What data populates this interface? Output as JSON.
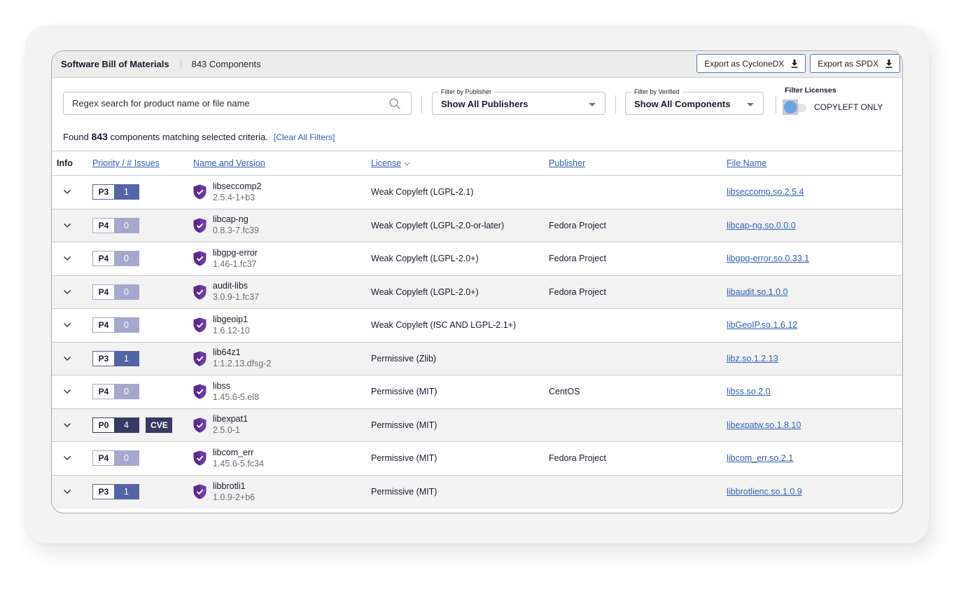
{
  "header": {
    "title": "Software Bill of Materials",
    "component_count": "843 Components",
    "export_cyclonedx": "Export as CycloneDX",
    "export_spdx": "Export as SPDX"
  },
  "filters": {
    "search_placeholder": "Regex search for product name or file name",
    "search_value": "",
    "publisher_legend": "Filter by Publisher",
    "publisher_value": "Show All Publishers",
    "verified_legend": "Filter by Verified",
    "verified_value": "Show All Components",
    "licenses_label": "Filter Licenses",
    "copyleft_toggle_label": "COPYLEFT ONLY",
    "copyleft_toggle_on": false,
    "found_prefix": "Found",
    "found_count": "843",
    "found_suffix": "components matching selected criteria.",
    "clear_all": "[Clear All Filters]"
  },
  "colors": {
    "priority_p3": "#5564a6",
    "priority_p4": "#a3a8cc",
    "priority_p0": "#363b63",
    "cve_badge": "#363b63",
    "shield": "#5a2a8a",
    "link": "#2f5fb3",
    "toggle_knob": "#6aa3e8"
  },
  "table": {
    "columns": {
      "info": "Info",
      "priority": "Priority / # Issues",
      "name": "Name and Version",
      "license": "License",
      "publisher": "Publisher",
      "file": "File Name"
    },
    "rows": [
      {
        "priority": "P3",
        "issues": "1",
        "cve": "",
        "name": "libseccomp2",
        "version": "2.5.4-1+b3",
        "license": "Weak Copyleft (LGPL-2.1)",
        "publisher": "",
        "file": "libseccomp.so.2.5.4"
      },
      {
        "priority": "P4",
        "issues": "0",
        "cve": "",
        "name": "libcap-ng",
        "version": "0.8.3-7.fc39",
        "license": "Weak Copyleft (LGPL-2.0-or-later)",
        "publisher": "Fedora Project",
        "file": "libcap-ng.so.0.0.0"
      },
      {
        "priority": "P4",
        "issues": "0",
        "cve": "",
        "name": "libgpg-error",
        "version": "1.46-1.fc37",
        "license": "Weak Copyleft (LGPL-2.0+)",
        "publisher": "Fedora Project",
        "file": "libgpg-error.so.0.33.1"
      },
      {
        "priority": "P4",
        "issues": "0",
        "cve": "",
        "name": "audit-libs",
        "version": "3.0.9-1.fc37",
        "license": "Weak Copyleft (LGPL-2.0+)",
        "publisher": "Fedora Project",
        "file": "libaudit.so.1.0.0"
      },
      {
        "priority": "P4",
        "issues": "0",
        "cve": "",
        "name": "libgeoip1",
        "version": "1.6.12-10",
        "license": "Weak Copyleft (ISC AND LGPL-2.1+)",
        "publisher": "",
        "file": "libGeoIP.so.1.6.12"
      },
      {
        "priority": "P3",
        "issues": "1",
        "cve": "",
        "name": "lib64z1",
        "version": "1:1.2.13.dfsg-2",
        "license": "Permissive (Zlib)",
        "publisher": "",
        "file": "libz.so.1.2.13"
      },
      {
        "priority": "P4",
        "issues": "0",
        "cve": "",
        "name": "libss",
        "version": "1.45.6-5.el8",
        "license": "Permissive (MIT)",
        "publisher": "CentOS",
        "file": "libss.so.2.0"
      },
      {
        "priority": "P0",
        "issues": "4",
        "cve": "CVE",
        "name": "libexpat1",
        "version": "2.5.0-1",
        "license": "Permissive (MIT)",
        "publisher": "",
        "file": "libexpatw.so.1.8.10"
      },
      {
        "priority": "P4",
        "issues": "0",
        "cve": "",
        "name": "libcom_err",
        "version": "1.45.6-5.fc34",
        "license": "Permissive (MIT)",
        "publisher": "Fedora Project",
        "file": "libcom_err.so.2.1"
      },
      {
        "priority": "P3",
        "issues": "1",
        "cve": "",
        "name": "libbrotli1",
        "version": "1.0.9-2+b6",
        "license": "Permissive (MIT)",
        "publisher": "",
        "file": "libbrotlienc.so.1.0.9"
      }
    ]
  }
}
